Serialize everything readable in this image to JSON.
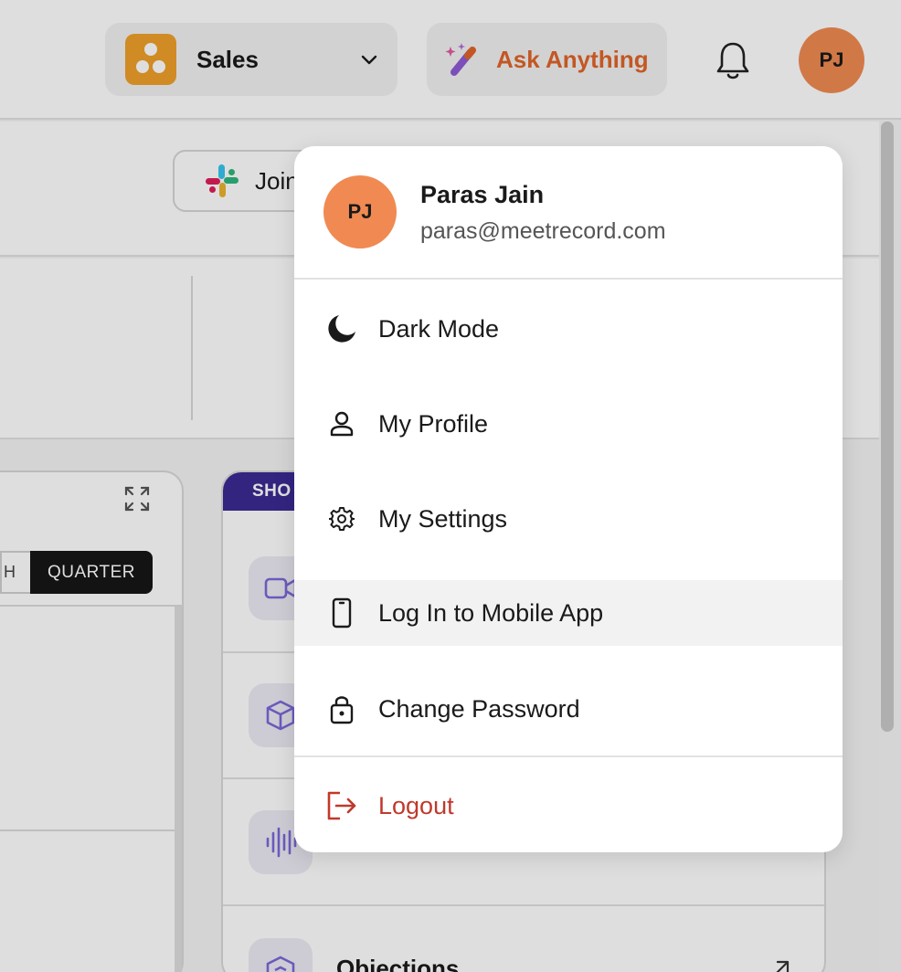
{
  "header": {
    "workspace_name": "Sales",
    "ask_label": "Ask Anything",
    "avatar_initials": "PJ"
  },
  "toolbar": {
    "join_label": "Join"
  },
  "left_card": {
    "month_label": "H",
    "quarter_label": "QUARTER"
  },
  "right_card": {
    "tab_label": "SHO",
    "objections_label": "Objections"
  },
  "user_menu": {
    "name": "Paras Jain",
    "email": "paras@meetrecord.com",
    "initials": "PJ",
    "items": [
      {
        "label": "Dark Mode",
        "icon": "moon-icon"
      },
      {
        "label": "My Profile",
        "icon": "user-icon"
      },
      {
        "label": "My Settings",
        "icon": "gear-icon"
      },
      {
        "label": "Log In to Mobile App",
        "icon": "phone-icon"
      },
      {
        "label": "Change Password",
        "icon": "lock-icon"
      }
    ],
    "logout_label": "Logout"
  },
  "colors": {
    "accent_orange": "#e0652a",
    "avatar_bg": "#f08a52",
    "workspace_logo": "#efa02a",
    "shortcuts_tab": "#3b2a94",
    "logout_red": "#c0392b"
  }
}
